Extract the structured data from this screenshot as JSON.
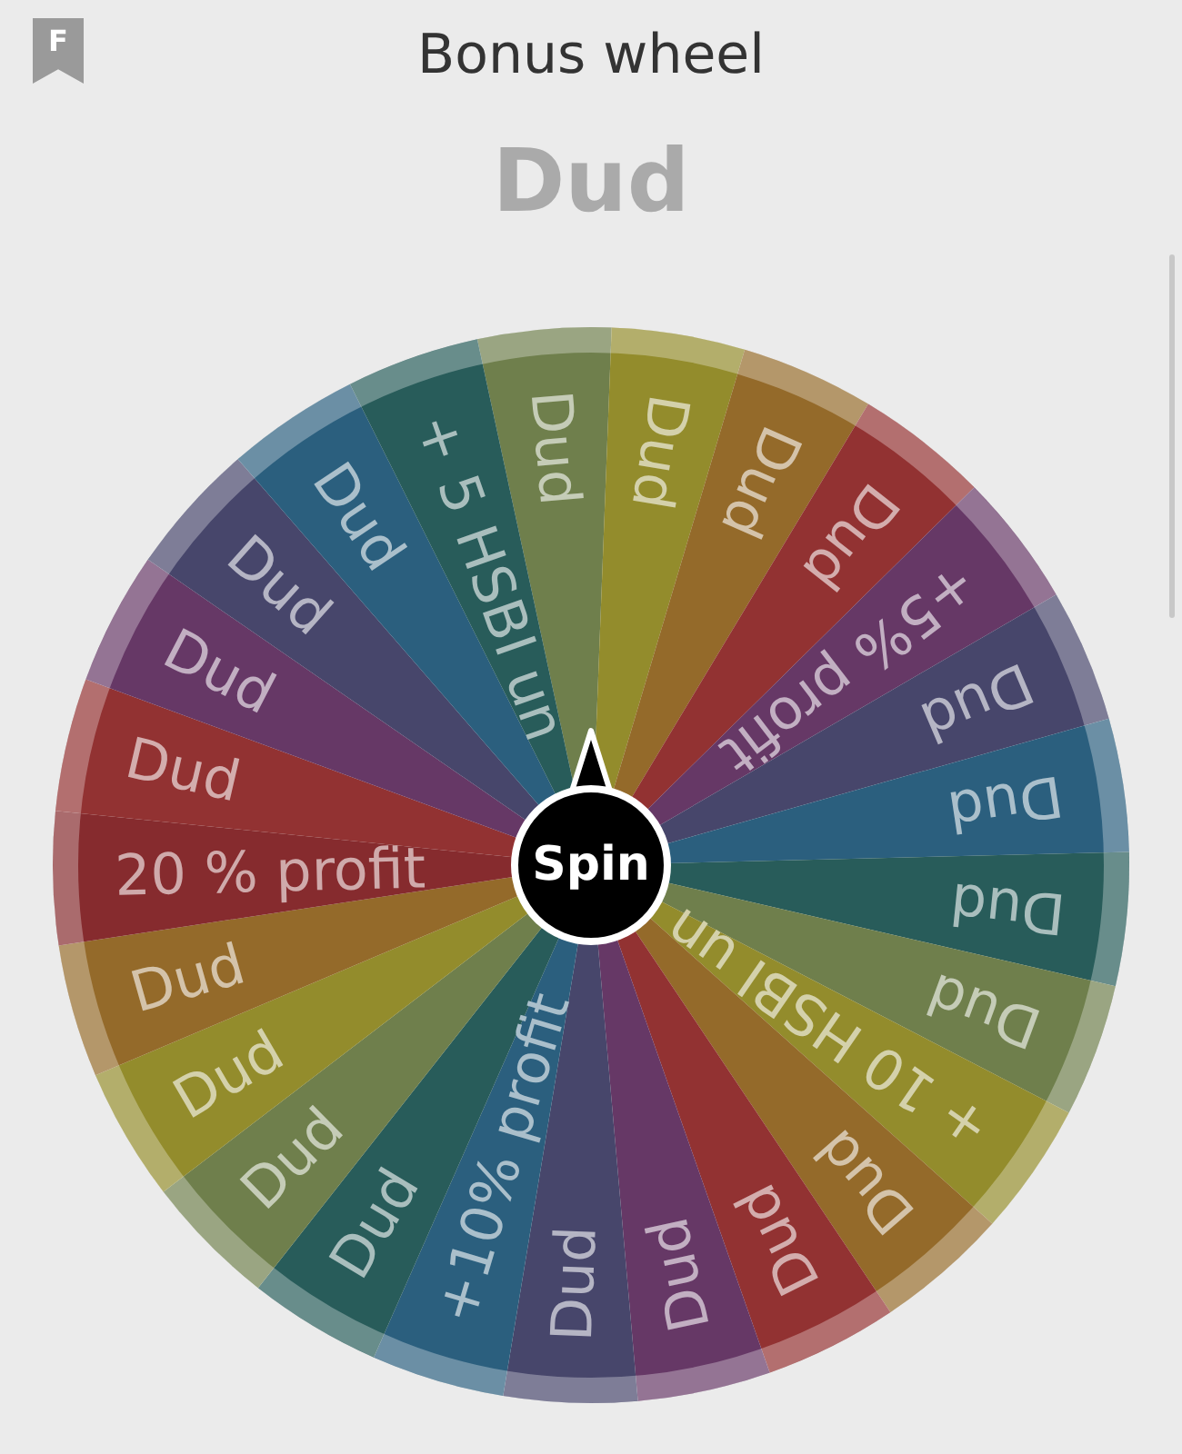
{
  "header": {
    "bookmark_letter": "F",
    "title": "Bonus wheel"
  },
  "result": "Dud",
  "wheel": {
    "segments": [
      {
        "label": "Dud",
        "color": "#6f7f4c"
      },
      {
        "label": "Dud",
        "color": "#938c2c"
      },
      {
        "label": "Dud",
        "color": "#946a2a"
      },
      {
        "label": "Dud",
        "color": "#923232"
      },
      {
        "label": "+5% profit",
        "color": "#663866"
      },
      {
        "label": "Dud",
        "color": "#47466b"
      },
      {
        "label": "Dud",
        "color": "#2b5f7e"
      },
      {
        "label": "Dud",
        "color": "#285c5a"
      },
      {
        "label": "Dud",
        "color": "#6f7f4c"
      },
      {
        "label": "+ 10 HSBI un",
        "color": "#938c2c"
      },
      {
        "label": "Dud",
        "color": "#946a2a"
      },
      {
        "label": "Dud",
        "color": "#923232"
      },
      {
        "label": "Dud",
        "color": "#663866"
      },
      {
        "label": "Dud",
        "color": "#47466b"
      },
      {
        "label": "+10% profit",
        "color": "#2b5f7e"
      },
      {
        "label": "Dud",
        "color": "#285c5a"
      },
      {
        "label": "Dud",
        "color": "#6f7f4c"
      },
      {
        "label": "Dud",
        "color": "#938c2c"
      },
      {
        "label": "Dud",
        "color": "#946a2a"
      },
      {
        "label": "20 % profit",
        "color": "#862b2e"
      },
      {
        "label": "Dud",
        "color": "#923232"
      },
      {
        "label": "Dud",
        "color": "#663866"
      },
      {
        "label": "Dud",
        "color": "#47466b"
      },
      {
        "label": "Dud",
        "color": "#2b5f7e"
      },
      {
        "label": "+ 5 HSBI un",
        "color": "#285c5a"
      }
    ]
  },
  "spin_button": {
    "label": "Spin"
  }
}
